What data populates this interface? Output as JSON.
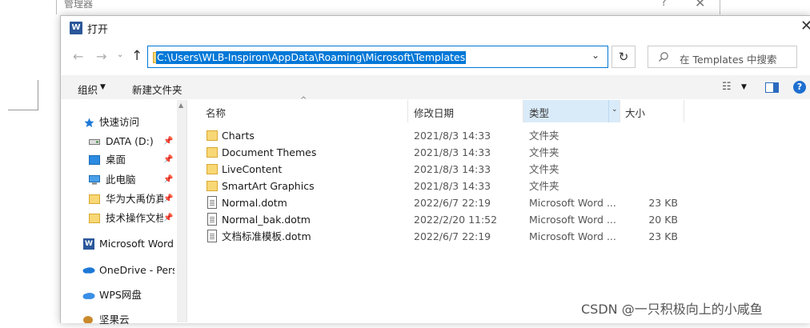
{
  "background_window": {
    "title": "管理器",
    "help": "?",
    "close": "✕"
  },
  "dialog": {
    "title": "打开",
    "icon_letter": "W",
    "close": "✕"
  },
  "navigation": {
    "back": "←",
    "forward": "→",
    "recent": "⌄",
    "up": "↑",
    "address": "C:\\Users\\WLB-Inspiron\\AppData\\Roaming\\Microsoft\\Templates",
    "address_chevron": "⌄",
    "refresh": "↻",
    "search_placeholder": "在 Templates 中搜索"
  },
  "toolbar": {
    "organize": "组织",
    "organize_caret": "▼",
    "new_folder": "新建文件夹",
    "view_glyph": "☷",
    "view_caret": "▼",
    "help": "?"
  },
  "sidebar": {
    "quick_access": "快速访问",
    "items": [
      {
        "label": "DATA (D:)",
        "icon": "drive-icon",
        "pinned": true
      },
      {
        "label": "桌面",
        "icon": "desktop-folder-icon",
        "pinned": true
      },
      {
        "label": "此电脑",
        "icon": "computer-icon",
        "pinned": true
      },
      {
        "label": "华为大禹仿真",
        "icon": "folder-icon",
        "pinned": true
      },
      {
        "label": "技术操作文档",
        "icon": "folder-icon",
        "pinned": true
      }
    ],
    "microsoft_word": "Microsoft Word",
    "onedrive": "OneDrive - Personal",
    "wps": "WPS网盘",
    "jianguoyun": "坚果云",
    "pin_glyph": "📌"
  },
  "columns": {
    "name": "名称",
    "sort_arrow": "^",
    "date": "修改日期",
    "type": "类型",
    "type_caret": "⌄",
    "size": "大小"
  },
  "files": [
    {
      "name": "Charts",
      "date": "2021/8/3 14:33",
      "type": "文件夹",
      "size": "",
      "kind": "folder"
    },
    {
      "name": "Document Themes",
      "date": "2021/8/3 14:33",
      "type": "文件夹",
      "size": "",
      "kind": "folder"
    },
    {
      "name": "LiveContent",
      "date": "2021/8/3 14:33",
      "type": "文件夹",
      "size": "",
      "kind": "folder"
    },
    {
      "name": "SmartArt Graphics",
      "date": "2021/8/3 14:33",
      "type": "文件夹",
      "size": "",
      "kind": "folder"
    },
    {
      "name": "Normal.dotm",
      "date": "2022/6/7 22:19",
      "type": "Microsoft Word ...",
      "size": "23 KB",
      "kind": "doc"
    },
    {
      "name": "Normal_bak.dotm",
      "date": "2022/2/20 11:52",
      "type": "Microsoft Word ...",
      "size": "20 KB",
      "kind": "doc"
    },
    {
      "name": "文档标准模板.dotm",
      "date": "2022/6/7 22:19",
      "type": "Microsoft Word ...",
      "size": "23 KB",
      "kind": "doc"
    }
  ],
  "watermark": "CSDN @一只积极向上的小咸鱼",
  "colors": {
    "accent": "#0078d7",
    "folder": "#f8d775",
    "header_highlight": "#d9ebf9"
  }
}
